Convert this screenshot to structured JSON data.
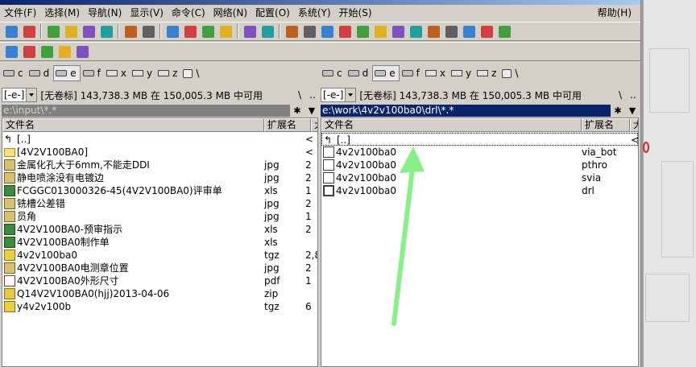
{
  "menu": [
    "文件(F)",
    "选择(M)",
    "导航(N)",
    "显示(V)",
    "命令(C)",
    "网络(N)",
    "配置(O)",
    "系统(Y)",
    "开始(S)"
  ],
  "menu_help": "帮助(H)",
  "drives": {
    "left": [
      {
        "letter": "c",
        "kind": "disk"
      },
      {
        "letter": "d",
        "kind": "disk"
      },
      {
        "letter": "e",
        "kind": "disk",
        "active": true
      },
      {
        "letter": "f",
        "kind": "disk"
      },
      {
        "letter": "x",
        "kind": "net"
      },
      {
        "letter": "y",
        "kind": "net"
      },
      {
        "letter": "z",
        "kind": "net"
      },
      {
        "letter": "\\",
        "kind": "pc"
      }
    ],
    "right": [
      {
        "letter": "c",
        "kind": "disk"
      },
      {
        "letter": "d",
        "kind": "disk"
      },
      {
        "letter": "e",
        "kind": "disk",
        "active": true
      },
      {
        "letter": "f",
        "kind": "disk"
      },
      {
        "letter": "x",
        "kind": "net"
      },
      {
        "letter": "y",
        "kind": "net"
      },
      {
        "letter": "z",
        "kind": "net"
      },
      {
        "letter": "\\",
        "kind": "pc"
      }
    ]
  },
  "left": {
    "drive_combo": "[-e-]",
    "free_info": "[无卷标]  143,738.3 MB 在 150,005.3 MB 中可用",
    "path": "e:\\input\\*.*",
    "col_name": "文件名",
    "col_ext": "扩展名",
    "col_size": "大",
    "files": [
      {
        "name": "[..]",
        "ext": "",
        "size": "<",
        "icon": "up"
      },
      {
        "name": "[4V2V100BA0]",
        "ext": "",
        "size": "<",
        "icon": "folder"
      },
      {
        "name": "金属化孔大于6mm,不能走DDI",
        "ext": "jpg",
        "size": "2",
        "icon": "jpg"
      },
      {
        "name": "静电喷涂没有电镀边",
        "ext": "jpg",
        "size": "2",
        "icon": "jpg"
      },
      {
        "name": "FCGGC013000326-45(4V2V100BA0)评审单",
        "ext": "xls",
        "size": "1",
        "icon": "xls"
      },
      {
        "name": "铣槽公差错",
        "ext": "jpg",
        "size": "2",
        "icon": "jpg"
      },
      {
        "name": "员角",
        "ext": "jpg",
        "size": "1",
        "icon": "jpg"
      },
      {
        "name": "4V2V100BA0-预审指示",
        "ext": "xls",
        "size": "2",
        "icon": "xls"
      },
      {
        "name": "4V2V100BA0制作单",
        "ext": "xls",
        "size": "",
        "icon": "xls"
      },
      {
        "name": "4v2v100ba0",
        "ext": "tgz",
        "size": "2,8",
        "icon": "tgz"
      },
      {
        "name": "4V2V100BA0电测章位置",
        "ext": "jpg",
        "size": "2",
        "icon": "jpg"
      },
      {
        "name": "4V2V100BA0外形尺寸",
        "ext": "pdf",
        "size": "1",
        "icon": "pdf"
      },
      {
        "name": "Q14V2V100BA0(hjj)2013-04-06",
        "ext": "zip",
        "size": "",
        "icon": "zip"
      },
      {
        "name": "y4v2v100b",
        "ext": "tgz",
        "size": "6",
        "icon": "tgz"
      }
    ]
  },
  "right": {
    "drive_combo": "[-e-]",
    "free_info": "[无卷标]  143,738.3 MB 在 150,005.3 MB 中可用",
    "path": "e:\\work\\4v2v100ba0\\drl\\*.*",
    "col_name": "文件名",
    "col_ext": "扩展名",
    "col_size": "大",
    "files": [
      {
        "name": "[..]",
        "ext": "",
        "size": "<",
        "icon": "up"
      },
      {
        "name": "4v2v100ba0",
        "ext": "via_bot",
        "size": "",
        "icon": "doc"
      },
      {
        "name": "4v2v100ba0",
        "ext": "pthro",
        "size": "",
        "icon": "doc"
      },
      {
        "name": "4v2v100ba0",
        "ext": "svia",
        "size": "",
        "icon": "doc"
      },
      {
        "name": "4v2v100ba0",
        "ext": "drl",
        "size": "",
        "icon": "drl"
      }
    ]
  },
  "toolbar_icons": [
    "refresh-icon",
    "view-icon",
    "brief-view-icon",
    "full-view-icon",
    "tree-view-icon",
    "sort-icon",
    "back-icon",
    "forward-icon",
    "pack-icon",
    "unpack-icon",
    "sync-icon",
    "compare-icon",
    "find-icon",
    "multi-rename-icon",
    "ftp-icon",
    "url-icon",
    "notepad-icon",
    "edit-icon",
    "calc-icon",
    "paint-icon",
    "acrobat-icon",
    "archive-icon",
    "parent-dir-icon",
    "package-icon",
    "pdf-icon",
    "word-icon",
    "shortcut-icon"
  ],
  "toolbar2_icons": [
    "box-icon",
    "save-icon",
    "cmd-icon",
    "folder-icon",
    "folder-open-icon"
  ],
  "panel_nav": {
    "root": "\\",
    "parent": ".."
  },
  "colors": {
    "arrow": "#88f088",
    "active_path_bg": "#0a246a",
    "inactive_path_bg": "#808080"
  }
}
